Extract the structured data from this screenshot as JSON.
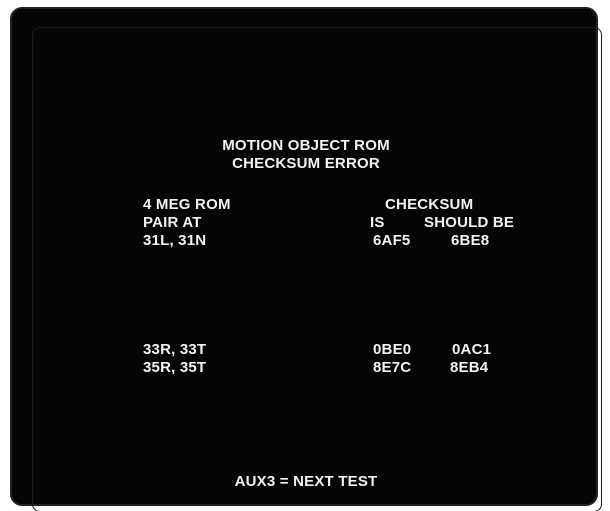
{
  "screen": {
    "title_line1": "MOTION OBJECT ROM",
    "title_line2": "CHECKSUM ERROR",
    "left_header_line1": "4 MEG ROM",
    "left_header_line2": "PAIR AT",
    "right_header": "CHECKSUM",
    "col_is": "IS",
    "col_should_be": "SHOULD BE",
    "rows": [
      {
        "pair": "31L, 31N",
        "is": "6AF5",
        "should_be": "6BE8"
      },
      {
        "pair": "33R, 33T",
        "is": "0BE0",
        "should_be": "0AC1"
      },
      {
        "pair": "35R, 35T",
        "is": "8E7C",
        "should_be": "8EB4"
      }
    ],
    "footer": "AUX3 = NEXT TEST"
  },
  "colors": {
    "background": "#050505",
    "text": "#f2f2f2",
    "bezel": "#ffffff"
  }
}
